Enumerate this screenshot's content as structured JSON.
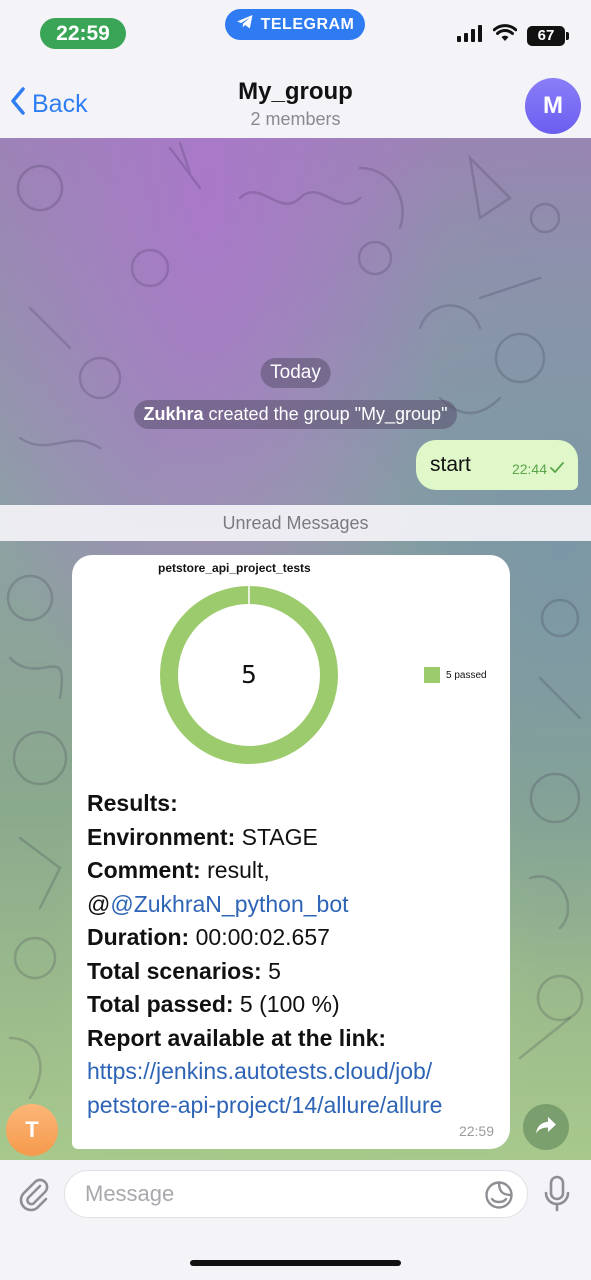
{
  "status_bar": {
    "time": "22:59",
    "app_label": "TELEGRAM",
    "battery": "67"
  },
  "nav": {
    "back_label": "Back",
    "title": "My_group",
    "subtitle": "2 members",
    "avatar_letter": "M"
  },
  "chat": {
    "date_label": "Today",
    "service_author": "Zukhra",
    "service_text": " created the group \"My_group\"",
    "outgoing": {
      "text": "start",
      "time": "22:44"
    },
    "unread_label": "Unread Messages",
    "incoming": {
      "sender_letter": "T",
      "time": "22:59",
      "lines": [
        {
          "label": "Results:",
          "value": ""
        },
        {
          "label": "Environment:",
          "value": " STAGE"
        },
        {
          "label": "Comment:",
          "value": " result,"
        },
        {
          "prefix": "@",
          "link": "@ZukhraN_python_bot"
        },
        {
          "label": "Duration:",
          "value": " 00:00:02.657"
        },
        {
          "label": "Total scenarios:",
          "value": " 5"
        },
        {
          "label": "Total passed:",
          "value": " 5 (100 %)"
        },
        {
          "label": "Report available at the link:",
          "value": ""
        }
      ],
      "report_link_line1": "https://jenkins.autotests.cloud/job/",
      "report_link_line2": "petstore-api-project/14/allure/allure"
    }
  },
  "chart_data": {
    "type": "pie",
    "title": "petstore_api_project_tests",
    "center_label": "5",
    "slices": [
      {
        "name": "5 passed",
        "value": 5,
        "color": "#9ccb6d"
      }
    ],
    "legend": "right"
  },
  "input": {
    "placeholder": "Message"
  },
  "colors": {
    "accent": "#2f7ef3",
    "outgoing_bubble": "#e0f8c9",
    "passed": "#9ccb6d",
    "link": "#2e64b5"
  }
}
